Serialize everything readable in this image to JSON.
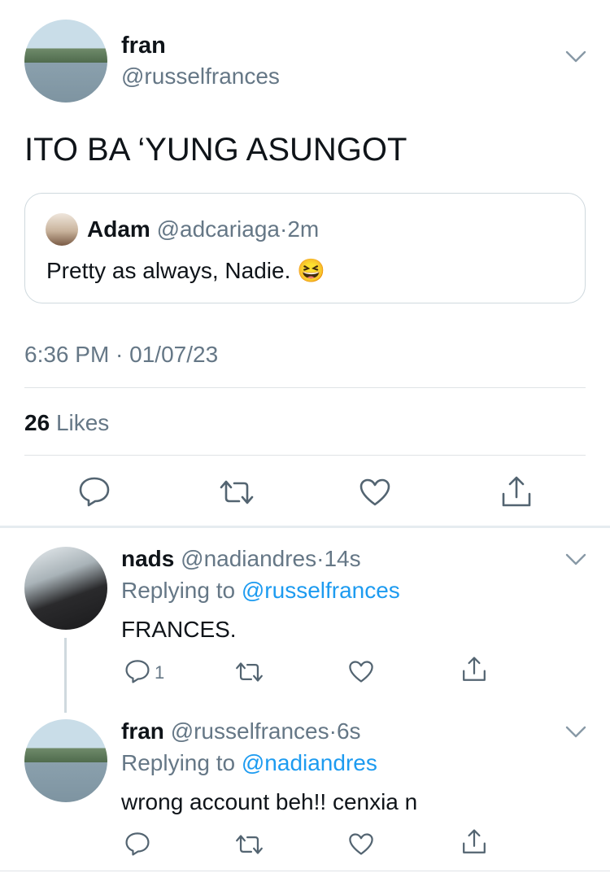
{
  "main_tweet": {
    "name": "fran",
    "handle": "@russelfrances",
    "text": "ITO BA ‘YUNG ASUNGOT",
    "quoted": {
      "name": "Adam",
      "handle": "@adcariaga",
      "dot": "·",
      "time": "2m",
      "text": "Pretty as always, Nadie.",
      "emoji": "😆"
    },
    "timestamp": "6:36 PM · 01/07/23",
    "likes_count": "26",
    "likes_label": "Likes"
  },
  "replies": [
    {
      "name": "nads",
      "handle": "@nadiandres",
      "dot": "·",
      "time": "14s",
      "replying_prefix": "Replying to",
      "replying_to": "@russelfrances",
      "text": "FRANCES.",
      "reply_count": "1"
    },
    {
      "name": "fran",
      "handle": "@russelfrances",
      "dot": "·",
      "time": "6s",
      "replying_prefix": "Replying to",
      "replying_to": "@nadiandres",
      "text": "wrong account beh!! cenxia n",
      "reply_count": ""
    }
  ],
  "icons": {
    "chevron": "chevron-down-icon",
    "reply": "reply-icon",
    "retweet": "retweet-icon",
    "like": "heart-icon",
    "share": "share-icon"
  },
  "colors": {
    "text": "#0f1419",
    "secondary": "#657786",
    "link": "#1d9bf0",
    "divider": "#dfe3e6"
  }
}
